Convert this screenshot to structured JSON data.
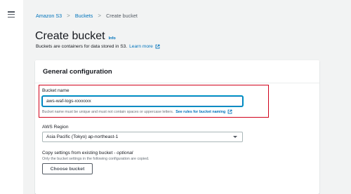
{
  "nav": {
    "menu_icon": "hamburger-menu-icon"
  },
  "breadcrumb": {
    "items": [
      "Amazon S3",
      "Buckets",
      "Create bucket"
    ],
    "separator": ">"
  },
  "page": {
    "title": "Create bucket",
    "info_label": "Info",
    "subtitle": "Buckets are containers for data stored in S3.",
    "learn_more": "Learn more"
  },
  "general_config": {
    "title": "General configuration",
    "bucket_name": {
      "label": "Bucket name",
      "value": "aws-waf-logs-xxxxxxx",
      "help": "Bucket name must be unique and must not contain spaces or uppercase letters.",
      "rules_link": "See rules for bucket naming"
    },
    "region": {
      "label": "AWS Region",
      "selected": "Asia Pacific (Tokyo) ap-northeast-1"
    },
    "copy_settings": {
      "label": "Copy settings from existing bucket",
      "optional": "optional",
      "dash": " - ",
      "description": "Only the bucket settings in the following configuration are copied.",
      "button": "Choose bucket"
    }
  },
  "colors": {
    "link": "#0073bb",
    "highlight": "#d0021b",
    "background": "#f2f3f3"
  }
}
